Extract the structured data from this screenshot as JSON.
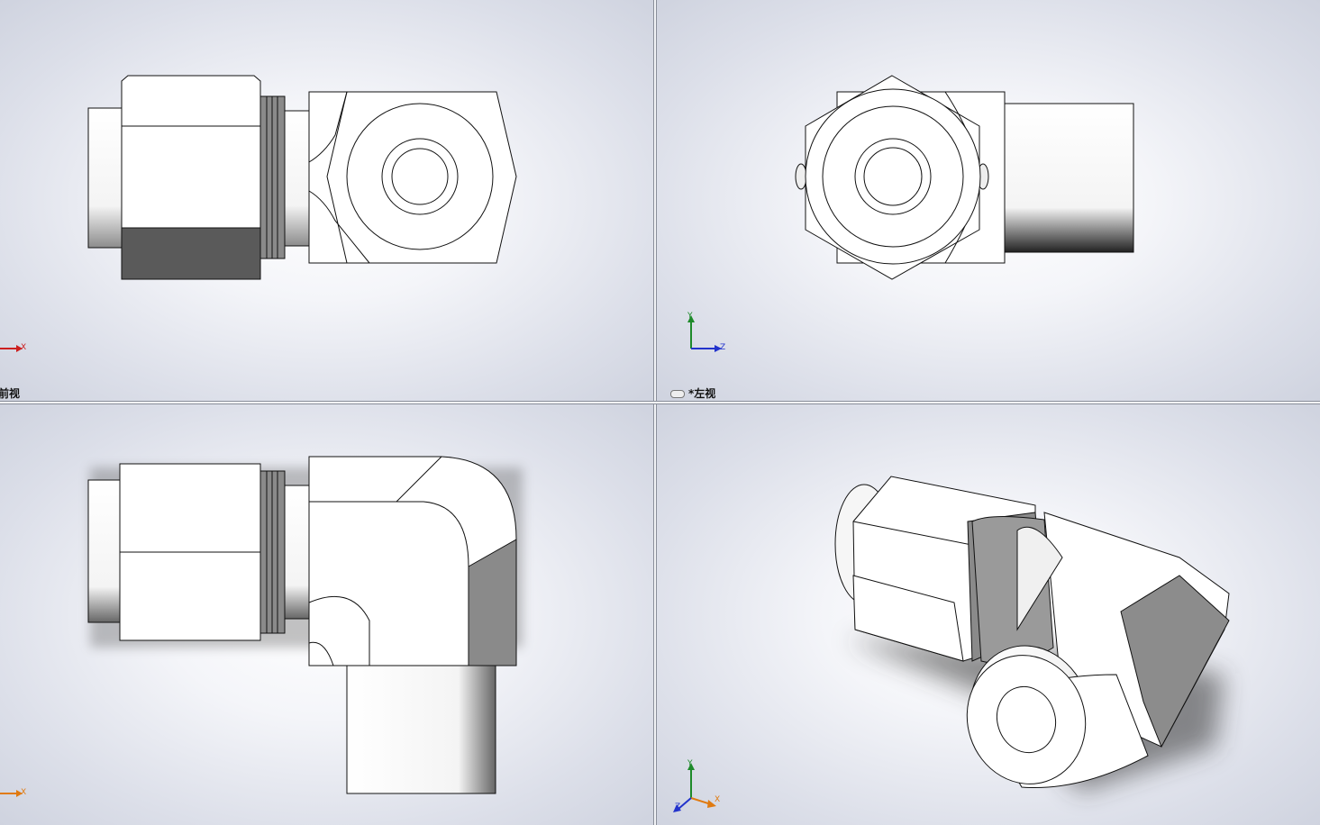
{
  "viewports": {
    "front": {
      "label": "前视",
      "axis_x": "X"
    },
    "left": {
      "label": "*左视",
      "axis_y": "Y",
      "axis_z": "Z"
    },
    "bottom": {
      "axis_x": "X"
    },
    "iso": {
      "axis_y": "Y",
      "axis_x": "X",
      "axis_z": "Z"
    }
  },
  "colors": {
    "axis_x": "#cc1f1f",
    "axis_y": "#1e8a2a",
    "axis_z": "#2233cc",
    "axis_x_alt": "#e07a10"
  }
}
